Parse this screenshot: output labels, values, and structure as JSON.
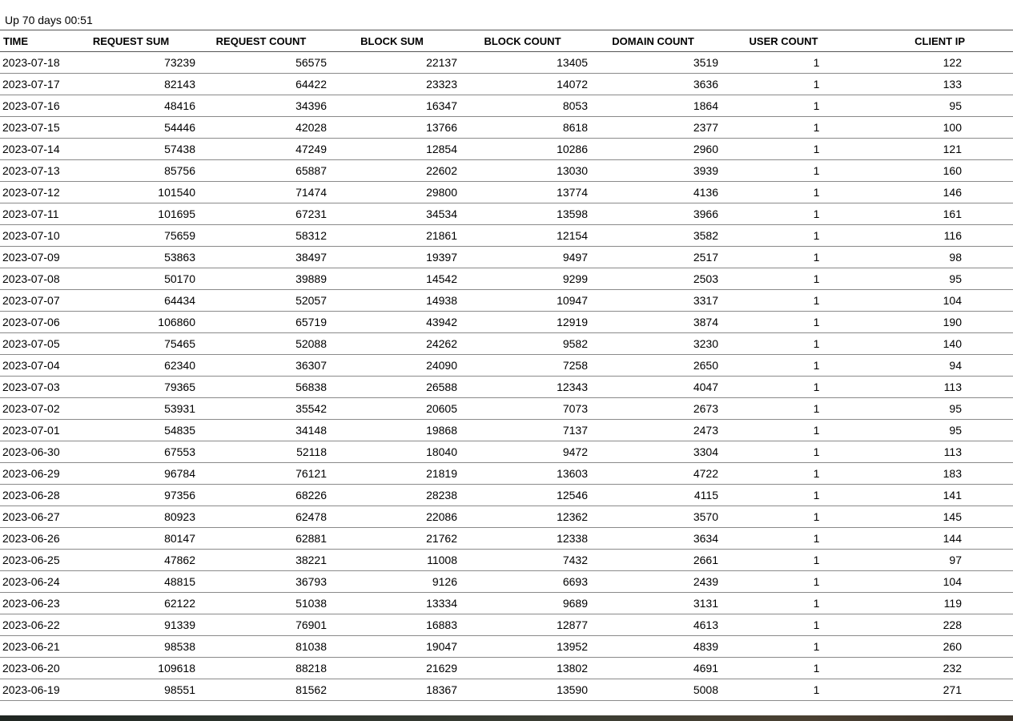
{
  "uptime": "Up 70 days 00:51",
  "table": {
    "headers": {
      "time": "TIME",
      "request_sum": "REQUEST SUM",
      "request_count": "REQUEST COUNT",
      "block_sum": "BLOCK SUM",
      "block_count": "BLOCK COUNT",
      "domain_count": "DOMAIN COUNT",
      "user_count": "USER COUNT",
      "client_ip": "CLIENT IP"
    },
    "rows": [
      [
        "2023-07-18",
        "73239",
        "56575",
        "22137",
        "13405",
        "3519",
        "1",
        "122"
      ],
      [
        "2023-07-17",
        "82143",
        "64422",
        "23323",
        "14072",
        "3636",
        "1",
        "133"
      ],
      [
        "2023-07-16",
        "48416",
        "34396",
        "16347",
        "8053",
        "1864",
        "1",
        "95"
      ],
      [
        "2023-07-15",
        "54446",
        "42028",
        "13766",
        "8618",
        "2377",
        "1",
        "100"
      ],
      [
        "2023-07-14",
        "57438",
        "47249",
        "12854",
        "10286",
        "2960",
        "1",
        "121"
      ],
      [
        "2023-07-13",
        "85756",
        "65887",
        "22602",
        "13030",
        "3939",
        "1",
        "160"
      ],
      [
        "2023-07-12",
        "101540",
        "71474",
        "29800",
        "13774",
        "4136",
        "1",
        "146"
      ],
      [
        "2023-07-11",
        "101695",
        "67231",
        "34534",
        "13598",
        "3966",
        "1",
        "161"
      ],
      [
        "2023-07-10",
        "75659",
        "58312",
        "21861",
        "12154",
        "3582",
        "1",
        "116"
      ],
      [
        "2023-07-09",
        "53863",
        "38497",
        "19397",
        "9497",
        "2517",
        "1",
        "98"
      ],
      [
        "2023-07-08",
        "50170",
        "39889",
        "14542",
        "9299",
        "2503",
        "1",
        "95"
      ],
      [
        "2023-07-07",
        "64434",
        "52057",
        "14938",
        "10947",
        "3317",
        "1",
        "104"
      ],
      [
        "2023-07-06",
        "106860",
        "65719",
        "43942",
        "12919",
        "3874",
        "1",
        "190"
      ],
      [
        "2023-07-05",
        "75465",
        "52088",
        "24262",
        "9582",
        "3230",
        "1",
        "140"
      ],
      [
        "2023-07-04",
        "62340",
        "36307",
        "24090",
        "7258",
        "2650",
        "1",
        "94"
      ],
      [
        "2023-07-03",
        "79365",
        "56838",
        "26588",
        "12343",
        "4047",
        "1",
        "113"
      ],
      [
        "2023-07-02",
        "53931",
        "35542",
        "20605",
        "7073",
        "2673",
        "1",
        "95"
      ],
      [
        "2023-07-01",
        "54835",
        "34148",
        "19868",
        "7137",
        "2473",
        "1",
        "95"
      ],
      [
        "2023-06-30",
        "67553",
        "52118",
        "18040",
        "9472",
        "3304",
        "1",
        "113"
      ],
      [
        "2023-06-29",
        "96784",
        "76121",
        "21819",
        "13603",
        "4722",
        "1",
        "183"
      ],
      [
        "2023-06-28",
        "97356",
        "68226",
        "28238",
        "12546",
        "4115",
        "1",
        "141"
      ],
      [
        "2023-06-27",
        "80923",
        "62478",
        "22086",
        "12362",
        "3570",
        "1",
        "145"
      ],
      [
        "2023-06-26",
        "80147",
        "62881",
        "21762",
        "12338",
        "3634",
        "1",
        "144"
      ],
      [
        "2023-06-25",
        "47862",
        "38221",
        "11008",
        "7432",
        "2661",
        "1",
        "97"
      ],
      [
        "2023-06-24",
        "48815",
        "36793",
        "9126",
        "6693",
        "2439",
        "1",
        "104"
      ],
      [
        "2023-06-23",
        "62122",
        "51038",
        "13334",
        "9689",
        "3131",
        "1",
        "119"
      ],
      [
        "2023-06-22",
        "91339",
        "76901",
        "16883",
        "12877",
        "4613",
        "1",
        "228"
      ],
      [
        "2023-06-21",
        "98538",
        "81038",
        "19047",
        "13952",
        "4839",
        "1",
        "260"
      ],
      [
        "2023-06-20",
        "109618",
        "88218",
        "21629",
        "13802",
        "4691",
        "1",
        "232"
      ],
      [
        "2023-06-19",
        "98551",
        "81562",
        "18367",
        "13590",
        "5008",
        "1",
        "271"
      ]
    ]
  }
}
